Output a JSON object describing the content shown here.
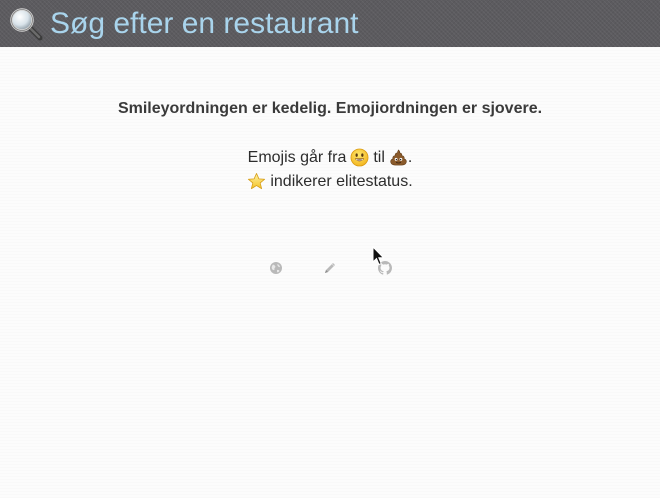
{
  "search": {
    "placeholder": "Søg efter en restaurant",
    "icon": "magnifying-glass-icon"
  },
  "intro": {
    "headline": "Smileyordningen er kedelig. Emojiordningen er sjovere.",
    "range_prefix": "Emojis går fra",
    "range_middle": "til",
    "range_suffix": ".",
    "range_start_icon": "smiley-face-icon",
    "range_end_icon": "pile-of-poo-icon",
    "elite_icon": "star-icon",
    "elite_text": "indikerer elitestatus."
  },
  "footer": {
    "links": [
      {
        "icon": "globe-icon"
      },
      {
        "icon": "pencil-icon"
      },
      {
        "icon": "github-icon"
      }
    ]
  },
  "colors": {
    "search_bar_bg": "#5c5b5f",
    "search_text": "#a9d4ec",
    "footer_icon": "#bdbdbd"
  }
}
